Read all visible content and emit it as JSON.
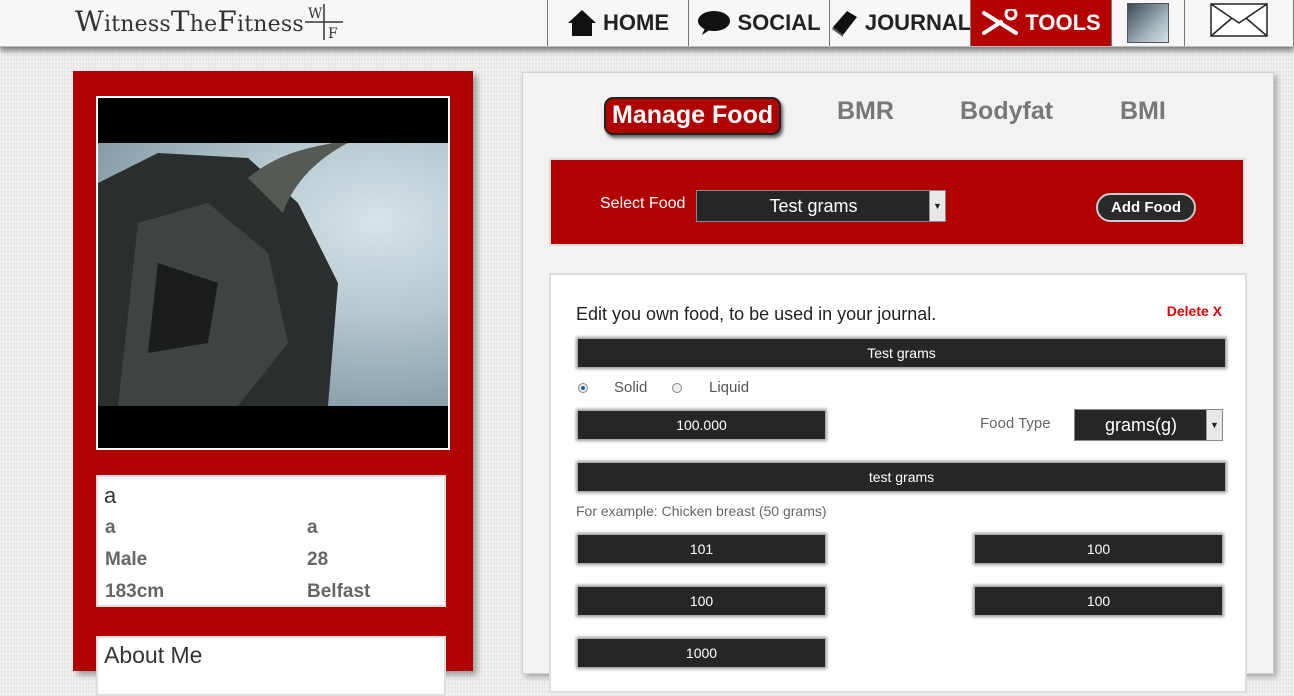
{
  "header": {
    "brand_w1": "W",
    "brand_r1": "itness",
    "brand_w2": "T",
    "brand_r2": "he",
    "brand_w3": "F",
    "brand_r3": "itness",
    "logo_w": "W",
    "logo_f": "F",
    "nav": {
      "home": "HOME",
      "social": "SOCIAL",
      "journal": "JOURNAL",
      "tools": "TOOLS"
    },
    "accent": "#b50000"
  },
  "profile": {
    "name": "a",
    "field1_left": "a",
    "field1_right": "a",
    "gender": "Male",
    "age": "28",
    "height": "183cm",
    "location": "Belfast",
    "about_title": "About Me"
  },
  "tools": {
    "tabs": {
      "manage_food": "Manage Food",
      "bmr": "BMR",
      "bodyfat": "Bodyfat",
      "bmi": "BMI"
    },
    "select_label": "Select Food",
    "selected_food": "Test grams",
    "add_food_label": "Add Food",
    "edit": {
      "title": "Edit you own food, to be used in your journal.",
      "delete_label": "Delete X",
      "food_name": "Test grams",
      "radio_solid": "Solid",
      "radio_liquid": "Liquid",
      "solid_selected": true,
      "quantity": "100.000",
      "food_type_label": "Food Type",
      "food_type_value": "grams(g)",
      "description": "test grams",
      "example_hint": "For example: Chicken breast (50 grams)",
      "val_a": "101",
      "val_b": "100",
      "val_c": "100",
      "val_d": "100",
      "val_e": "1000"
    }
  }
}
